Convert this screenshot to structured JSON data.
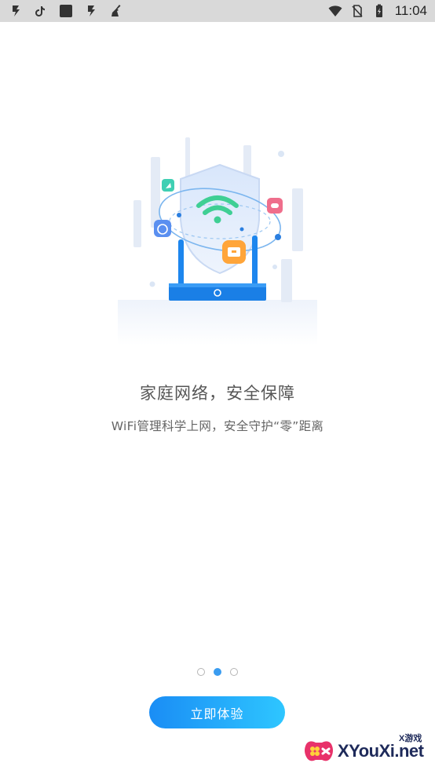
{
  "status_bar": {
    "time": "11:04",
    "left_icons": [
      "flash-app-icon",
      "tiktok-icon",
      "square-app-icon",
      "flash-app-icon",
      "broom-icon"
    ],
    "right_icons": [
      "wifi-icon",
      "no-sim-icon",
      "battery-charging-icon"
    ]
  },
  "onboarding": {
    "title": "家庭网络，安全保障",
    "subtitle": "WiFi管理科学上网，安全守护“零”距离",
    "page_count": 3,
    "active_page": 2
  },
  "cta": {
    "label": "立即体验"
  },
  "watermark": {
    "brand": "XYouXi.net",
    "tag": "X游戏"
  },
  "colors": {
    "accent": "#1a8df5",
    "accent_end": "#2ec6ff",
    "wifi_green": "#3fcf94",
    "title_text": "#555555"
  }
}
